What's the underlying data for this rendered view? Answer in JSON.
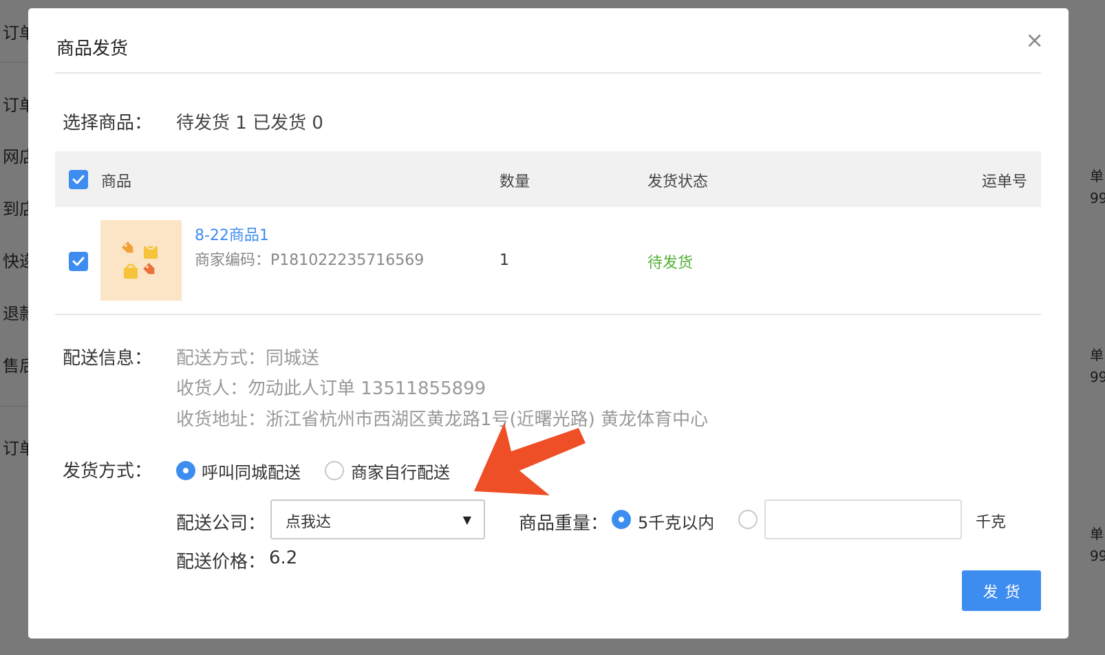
{
  "background": {
    "left_labels": [
      "订单",
      "订单",
      "网店",
      "到店",
      "快递",
      "退款",
      "售后",
      "订单"
    ],
    "right_labels": [
      "单",
      "99",
      "单",
      "99",
      "单",
      "99"
    ]
  },
  "modal": {
    "title": "商品发货",
    "close_symbol": "×",
    "select_goods": {
      "label": "选择商品：",
      "summary": "待发货 1 已发货 0"
    },
    "table": {
      "headers": {
        "product": "商品",
        "quantity": "数量",
        "status": "发货状态",
        "waybill": "运单号"
      },
      "rows": [
        {
          "name": "8-22商品1",
          "code": "商家编码：P181022235716569",
          "quantity": "1",
          "status": "待发货",
          "waybill": ""
        }
      ]
    },
    "delivery_info": {
      "label": "配送信息：",
      "method": "配送方式：同城送",
      "receiver": "收货人：勿动此人订单 13511855899",
      "address": "收货地址：浙江省杭州市西湖区黄龙路1号(近曙光路) 黄龙体育中心"
    },
    "ship_method": {
      "label": "发货方式：",
      "options": [
        "呼叫同城配送",
        "商家自行配送"
      ],
      "selected": "呼叫同城配送"
    },
    "delivery_company": {
      "label": "配送公司：",
      "value": "点我达"
    },
    "weight": {
      "label": "商品重量：",
      "option_preset": "5千克以内",
      "input_value": "",
      "unit": "千克"
    },
    "price": {
      "label": "配送价格：",
      "value": "6.2"
    },
    "submit_label": "发货"
  },
  "colors": {
    "accent": "#3d8cf0",
    "status_pending": "#52b035",
    "annotation_arrow": "#ee4f27"
  }
}
